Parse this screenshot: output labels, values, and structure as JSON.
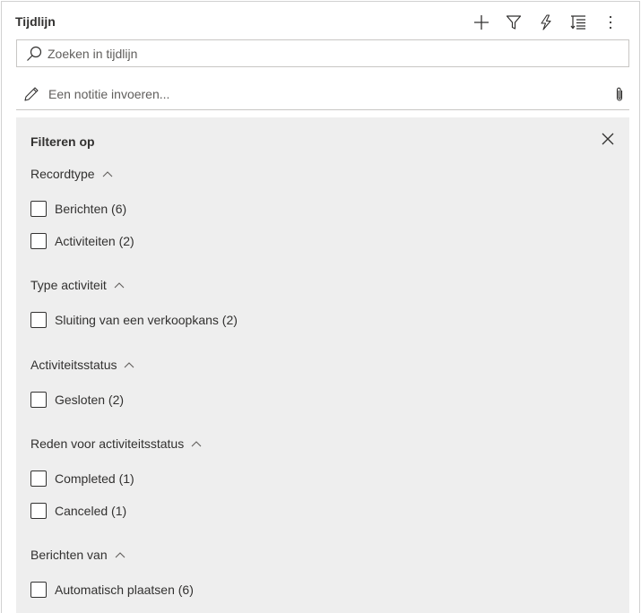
{
  "header": {
    "title": "Tijdlijn",
    "toolbar": [
      {
        "name": "add-icon",
        "label": "Toevoegen"
      },
      {
        "name": "filter-icon",
        "label": "Filteren"
      },
      {
        "name": "flash-icon",
        "label": "Snel"
      },
      {
        "name": "sort-icon",
        "label": "Sorteren"
      },
      {
        "name": "more-icon",
        "label": "Meer opties"
      }
    ]
  },
  "search": {
    "placeholder": "Zoeken in tijdlijn",
    "value": ""
  },
  "note": {
    "placeholder": "Een notitie invoeren..."
  },
  "filter": {
    "title": "Filteren op",
    "sections": [
      {
        "label": "Recordtype",
        "expanded": true,
        "options": [
          {
            "label": "Berichten (6)",
            "checked": false
          },
          {
            "label": "Activiteiten (2)",
            "checked": false
          }
        ]
      },
      {
        "label": "Type activiteit",
        "expanded": true,
        "options": [
          {
            "label": "Sluiting van een verkoopkans (2)",
            "checked": false
          }
        ]
      },
      {
        "label": "Activiteitsstatus",
        "expanded": true,
        "options": [
          {
            "label": "Gesloten (2)",
            "checked": false
          }
        ]
      },
      {
        "label": "Reden voor activiteitsstatus",
        "expanded": true,
        "options": [
          {
            "label": "Completed (1)",
            "checked": false
          },
          {
            "label": "Canceled (1)",
            "checked": false
          }
        ]
      },
      {
        "label": "Berichten van",
        "expanded": true,
        "options": [
          {
            "label": "Automatisch plaatsen (6)",
            "checked": false
          }
        ]
      }
    ]
  }
}
